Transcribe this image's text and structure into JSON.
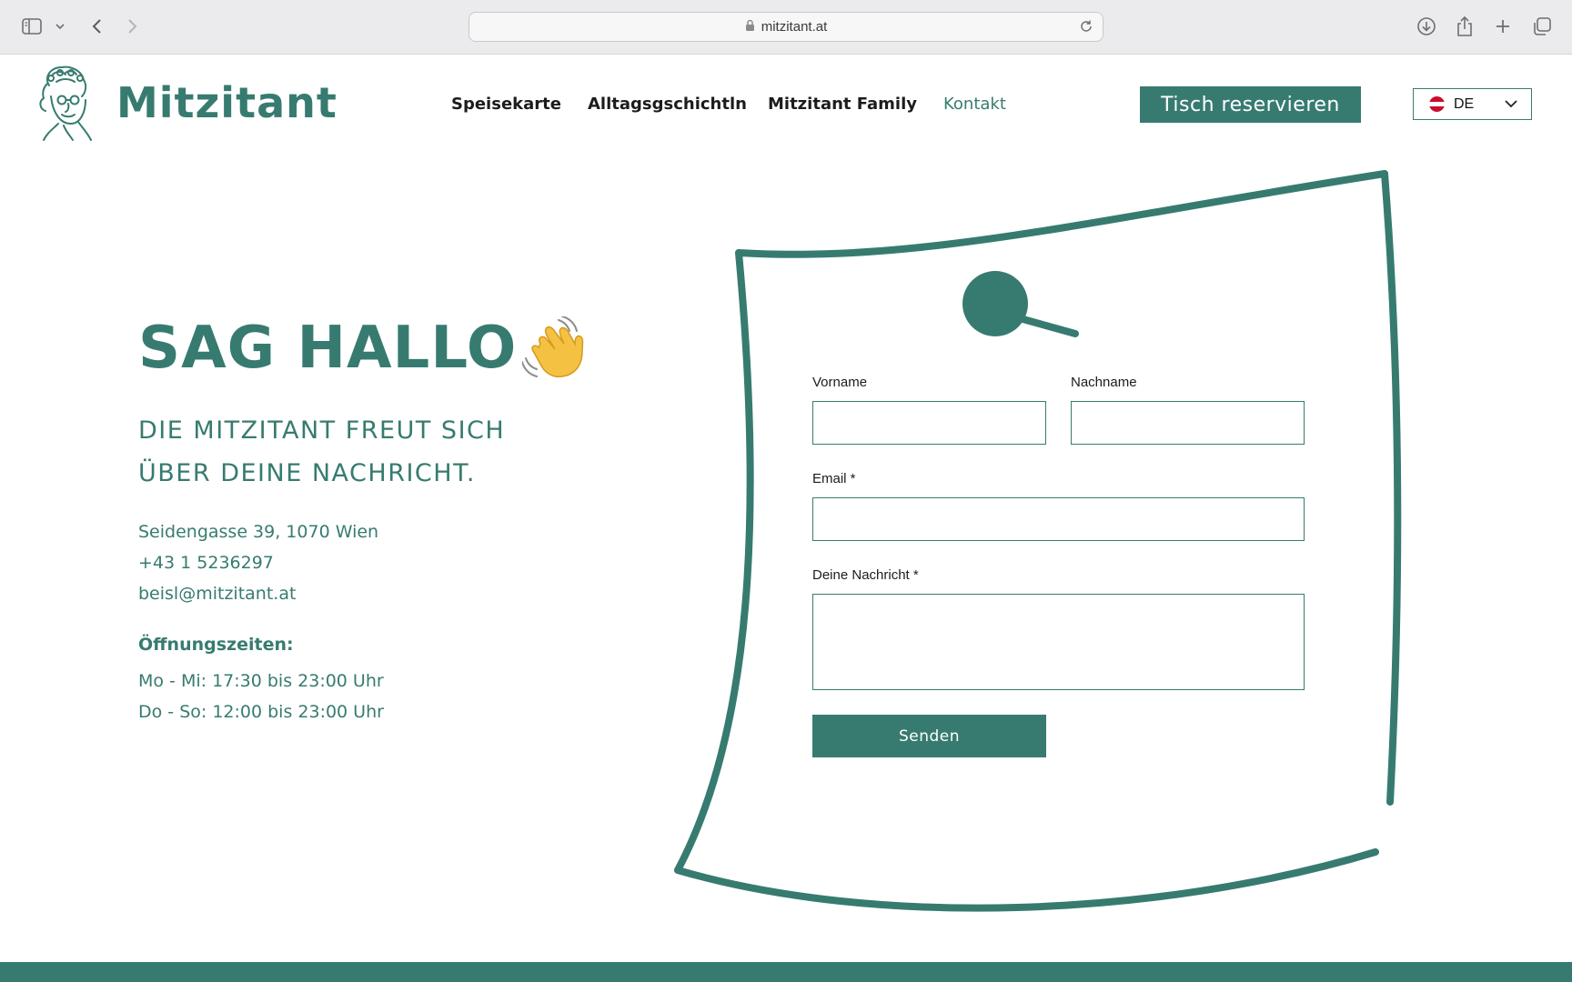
{
  "browser": {
    "url": "mitzitant.at"
  },
  "header": {
    "logo_text": "Mitzitant",
    "nav": [
      {
        "label": "Speisekarte",
        "active": false
      },
      {
        "label": "Alltagsgschichtln",
        "active": false
      },
      {
        "label": "Mitzitant Family",
        "active": false
      },
      {
        "label": "Kontakt",
        "active": true
      }
    ],
    "reserve_label": "Tisch reservieren",
    "language": "DE"
  },
  "hero": {
    "title": "SAG HALLO",
    "subtitle_line1": "DIE MITZITANT FREUT SICH",
    "subtitle_line2": "ÜBER DEINE NACHRICHT.",
    "address": "Seidengasse 39, 1070 Wien",
    "phone": "+43 1 5236297",
    "email": "beisl@mitzitant.at",
    "hours_title": "Öffnungszeiten:",
    "hours_line1": "Mo - Mi: 17:30 bis 23:00 Uhr",
    "hours_line2": "Do - So: 12:00 bis 23:00 Uhr"
  },
  "form": {
    "first_name_label": "Vorname",
    "first_name_value": "",
    "last_name_label": "Nachname",
    "last_name_value": "",
    "email_label": "Email *",
    "email_value": "",
    "message_label": "Deine Nachricht *",
    "message_value": "",
    "submit_label": "Senden"
  },
  "colors": {
    "brand_green": "#377b70",
    "flag_red": "#c8102e"
  },
  "icons": [
    "sidebar-icon",
    "chevron-down-icon",
    "back-icon",
    "forward-icon",
    "lock-icon",
    "reload-icon",
    "download-icon",
    "share-icon",
    "new-tab-icon",
    "tabs-overview-icon",
    "waving-hand-icon",
    "austria-flag-icon"
  ]
}
